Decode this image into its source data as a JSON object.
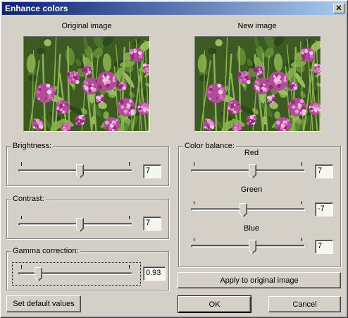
{
  "window": {
    "title": "Enhance colors",
    "close_glyph": "✕"
  },
  "images": {
    "original_label": "Original image",
    "new_label": "New image"
  },
  "brightness": {
    "label": "Brightness:",
    "value": "7",
    "level": 0.54
  },
  "contrast": {
    "label": "Contrast:",
    "value": "7",
    "level": 0.54
  },
  "gamma": {
    "label": "Gamma correction:",
    "value": "0.93",
    "level": 0.16
  },
  "color_balance": {
    "label": "Color balance:",
    "red": {
      "label": "Red",
      "value": "7",
      "level": 0.54
    },
    "green": {
      "label": "Green",
      "value": "-7",
      "level": 0.46
    },
    "blue": {
      "label": "Blue",
      "value": "7",
      "level": 0.54
    }
  },
  "buttons": {
    "apply": "Apply to original image",
    "defaults": "Set default values",
    "ok": "OK",
    "cancel": "Cancel"
  },
  "colors": {
    "title_start": "#0a246a",
    "title_end": "#a6caf0",
    "face": "#d4d0c8"
  }
}
